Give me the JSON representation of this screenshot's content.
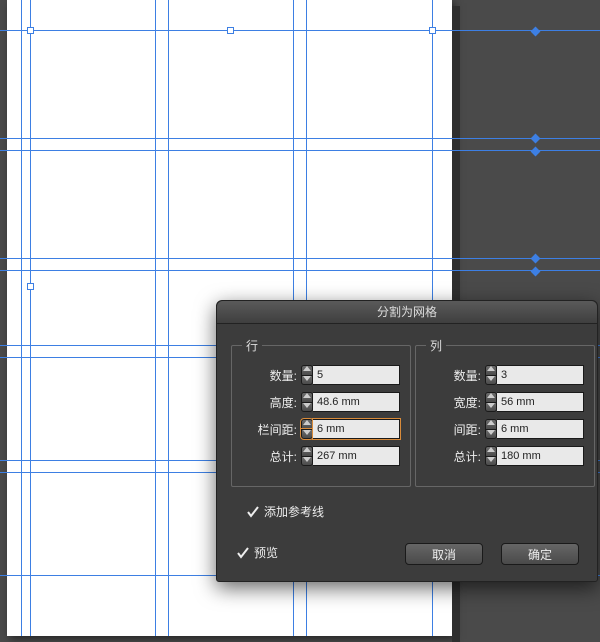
{
  "dialog": {
    "title": "分割为网格",
    "rows": {
      "legend": "行",
      "count_label": "数量:",
      "count_value": "5",
      "height_label": "高度:",
      "height_value": "48.6 mm",
      "gutter_label": "栏间距:",
      "gutter_value": "6 mm",
      "total_label": "总计:",
      "total_value": "267 mm"
    },
    "cols": {
      "legend": "列",
      "count_label": "数量:",
      "count_value": "3",
      "width_label": "宽度:",
      "width_value": "56 mm",
      "gutter_label": "间距:",
      "gutter_value": "6 mm",
      "total_label": "总计:",
      "total_value": "180 mm"
    },
    "add_guides_label": "添加参考线",
    "preview_label": "预览",
    "cancel": "取消",
    "ok": "确定"
  }
}
